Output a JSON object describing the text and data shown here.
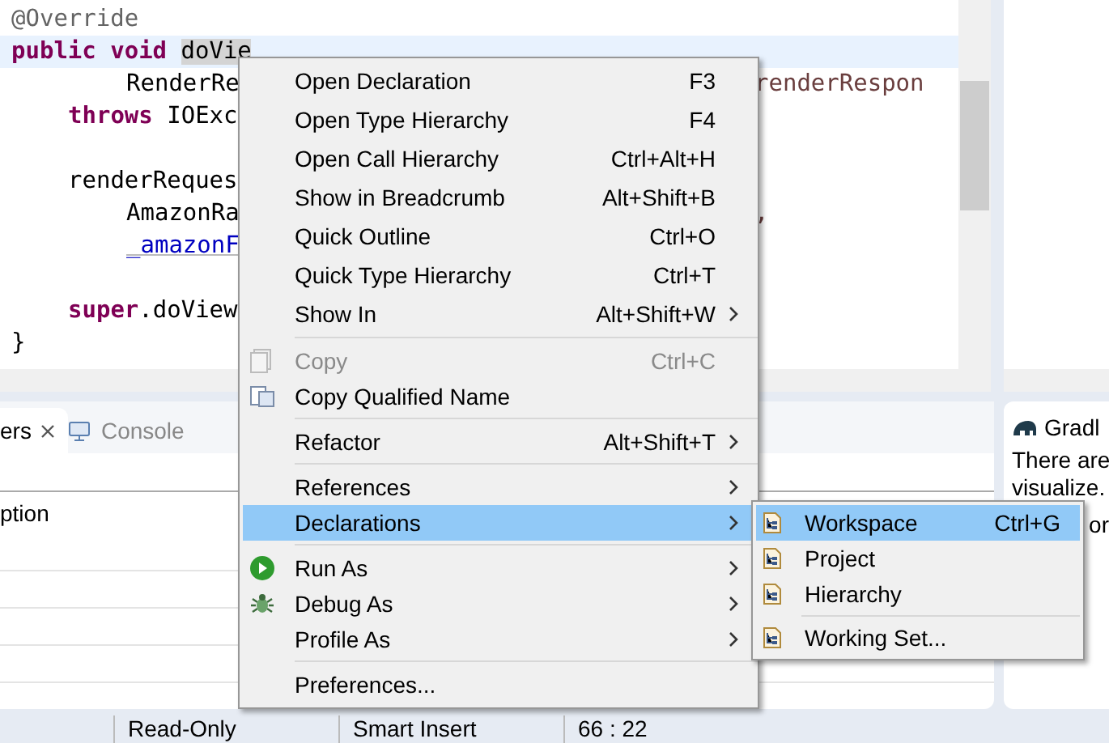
{
  "editor": {
    "lines": [
      {
        "kind": "top",
        "current": false,
        "left": [
          {
            "kind": "annotation",
            "text": "@Override"
          }
        ]
      },
      {
        "kind": "top",
        "current": true,
        "left": [
          {
            "kind": "keyword",
            "text": "public "
          },
          {
            "kind": "keyword",
            "text": "void "
          },
          {
            "kind": "selected",
            "text": "doVie"
          }
        ]
      },
      {
        "kind": "wrapped",
        "current": false,
        "left": [
          {
            "kind": "plain",
            "text": "RenderRe"
          }
        ],
        "right": "renderRespon"
      },
      {
        "kind": "body",
        "current": false,
        "left": [
          {
            "kind": "keyword",
            "text": "throws "
          },
          {
            "kind": "plain",
            "text": "IOExc"
          }
        ]
      },
      {
        "kind": "blank",
        "current": false
      },
      {
        "kind": "body",
        "current": false,
        "left": [
          {
            "kind": "plain",
            "text": "renderReques"
          }
        ]
      },
      {
        "kind": "wrapped",
        "current": false,
        "left": [
          {
            "kind": "plain",
            "text": "AmazonRa"
          }
        ],
        "right": ","
      },
      {
        "kind": "wrapped",
        "current": false,
        "left": [
          {
            "kind": "field",
            "text": "_amazonF"
          }
        ]
      },
      {
        "kind": "blank",
        "current": false
      },
      {
        "kind": "body",
        "current": false,
        "left": [
          {
            "kind": "keyword",
            "text": "super"
          },
          {
            "kind": "plain",
            "text": ".doView"
          }
        ]
      },
      {
        "kind": "top",
        "current": false,
        "left": [
          {
            "kind": "plain",
            "text": "}"
          }
        ]
      }
    ]
  },
  "bottom_panel": {
    "tabs": [
      {
        "label": "ers",
        "selected": true
      },
      {
        "label": "Console",
        "selected": false
      }
    ],
    "column_1": "ption"
  },
  "gradle_panel": {
    "title": "Gradl",
    "lines": [
      "There are",
      "visualize."
    ],
    "trailing": "or"
  },
  "status_bar": [
    "Read-Only",
    "Smart Insert",
    "66 : 22"
  ],
  "context_menu": [
    {
      "kind": "item",
      "label": "Open Declaration",
      "shortcut": "F3",
      "submenu": false,
      "disabled": false,
      "selected": false
    },
    {
      "kind": "item",
      "label": "Open Type Hierarchy",
      "shortcut": "F4",
      "submenu": false,
      "disabled": false,
      "selected": false
    },
    {
      "kind": "item",
      "label": "Open Call Hierarchy",
      "shortcut": "Ctrl+Alt+H",
      "submenu": false,
      "disabled": false,
      "selected": false
    },
    {
      "kind": "item",
      "label": "Show in Breadcrumb",
      "shortcut": "Alt+Shift+B",
      "submenu": false,
      "disabled": false,
      "selected": false
    },
    {
      "kind": "item",
      "label": "Quick Outline",
      "shortcut": "Ctrl+O",
      "submenu": false,
      "disabled": false,
      "selected": false
    },
    {
      "kind": "item",
      "label": "Quick Type Hierarchy",
      "shortcut": "Ctrl+T",
      "submenu": false,
      "disabled": false,
      "selected": false
    },
    {
      "kind": "item",
      "label": "Show In",
      "shortcut": "Alt+Shift+W",
      "submenu": true,
      "disabled": false,
      "selected": false
    },
    {
      "kind": "separator"
    },
    {
      "kind": "item",
      "label": "Copy",
      "shortcut": "Ctrl+C",
      "submenu": false,
      "disabled": true,
      "selected": false
    },
    {
      "kind": "item",
      "label": "Copy Qualified Name",
      "submenu": false,
      "disabled": false,
      "selected": false
    },
    {
      "kind": "separator"
    },
    {
      "kind": "item",
      "label": "Refactor",
      "shortcut": "Alt+Shift+T",
      "submenu": true,
      "disabled": false,
      "selected": false
    },
    {
      "kind": "separator"
    },
    {
      "kind": "item",
      "label": "References",
      "submenu": true,
      "disabled": false,
      "selected": false
    },
    {
      "kind": "item",
      "label": "Declarations",
      "submenu": true,
      "disabled": false,
      "selected": true
    },
    {
      "kind": "separator"
    },
    {
      "kind": "item",
      "label": "Run As",
      "submenu": true,
      "disabled": false,
      "selected": false
    },
    {
      "kind": "item",
      "label": "Debug As",
      "submenu": true,
      "disabled": false,
      "selected": false
    },
    {
      "kind": "item",
      "label": "Profile As",
      "submenu": true,
      "disabled": false,
      "selected": false
    },
    {
      "kind": "separator"
    },
    {
      "kind": "item",
      "label": "Preferences...",
      "submenu": false,
      "disabled": false,
      "selected": false
    }
  ],
  "submenu": [
    {
      "kind": "item",
      "label": "Workspace",
      "shortcut": "Ctrl+G",
      "selected": true
    },
    {
      "kind": "item",
      "label": "Project",
      "selected": false
    },
    {
      "kind": "item",
      "label": "Hierarchy",
      "selected": false
    },
    {
      "kind": "separator"
    },
    {
      "kind": "item",
      "label": "Working Set...",
      "selected": false
    }
  ]
}
